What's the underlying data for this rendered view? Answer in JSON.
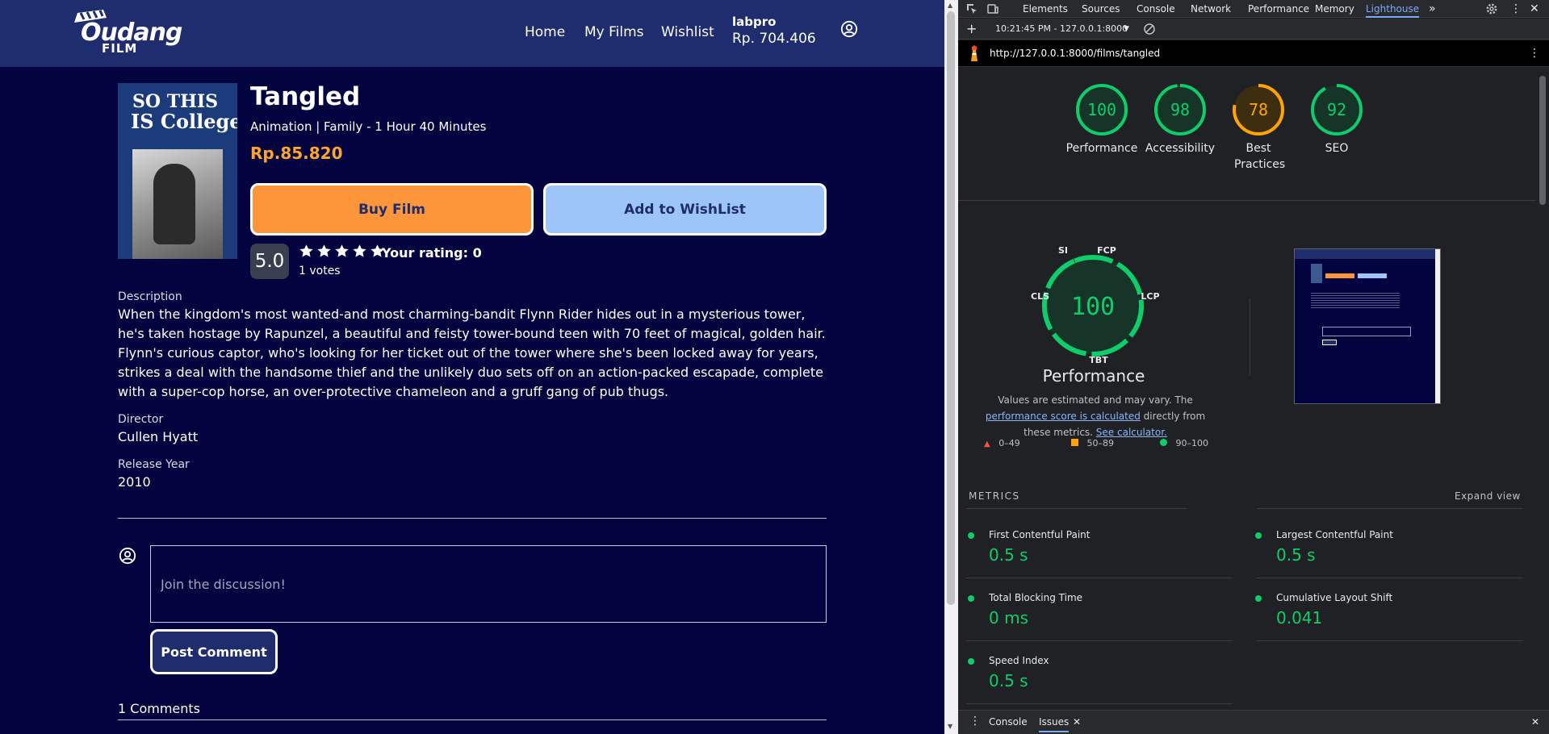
{
  "site": {
    "logo": {
      "line1": "Oudang",
      "line2": "FILM"
    },
    "nav": {
      "links": [
        "Home",
        "My Films",
        "Wishlist"
      ],
      "user_name": "labpro",
      "balance": "Rp. 704.406"
    },
    "poster": {
      "line1": "SO THIS",
      "line2": "IS College"
    },
    "film": {
      "title": "Tangled",
      "meta": "Animation | Family - 1 Hour 40 Minutes",
      "price": "Rp.85.820",
      "buy_label": "Buy Film",
      "wishlist_label": "Add to WishList",
      "rating": "5.0",
      "stars": 5,
      "your_rating": "Your rating: 0",
      "votes": "1 votes",
      "description_label": "Description",
      "description": "When the kingdom's most wanted-and most charming-bandit Flynn Rider hides out in a mysterious tower, he's taken hostage by Rapunzel, a beautiful and feisty tower-bound teen with 70 feet of magical, golden hair. Flynn's curious captor, who's looking for her ticket out of the tower where she's been locked away for years, strikes a deal with the handsome thief and the unlikely duo sets off on an action-packed escapade, complete with a super-cop horse, an over-protective chameleon and a gruff gang of pub thugs.",
      "director_label": "Director",
      "director": "Cullen Hyatt",
      "release_label": "Release Year",
      "release_year": "2010"
    },
    "comments": {
      "placeholder": "Join the discussion!",
      "post_label": "Post Comment",
      "count_label": "1 Comments"
    },
    "colors": {
      "nav_bg": "#1f2c6e",
      "page_bg": "#02033f",
      "price": "#ffa42e",
      "buy_button": "#fd963b",
      "wishlist_button": "#9ec5fa"
    }
  },
  "devtools": {
    "tabs": [
      "Elements",
      "Sources",
      "Console",
      "Network",
      "Performance",
      "Memory",
      "Lighthouse"
    ],
    "active_tab": "Lighthouse",
    "more_tabs_icon": "chevron-double-right-icon",
    "report_time": "10:21:45 PM - 127.0.0.1:8000",
    "url": "http://127.0.0.1:8000/films/tangled",
    "scores": [
      {
        "label": "Performance",
        "score": 100,
        "color": "#0cce6b"
      },
      {
        "label": "Accessibility",
        "score": 98,
        "color": "#0cce6b"
      },
      {
        "label": "Best Practices",
        "score": 78,
        "color": "#ffa400"
      },
      {
        "label": "SEO",
        "score": 92,
        "color": "#0cce6b"
      }
    ],
    "perf_gauge": {
      "score": "100",
      "labels": {
        "si": "SI",
        "fcp": "FCP",
        "lcp": "LCP",
        "tbt": "TBT",
        "cls": "CLS"
      }
    },
    "perf_title": "Performance",
    "perf_note": {
      "before": "Values are estimated and may vary. The ",
      "link1": "performance score is calculated",
      "middle": " directly from these metrics. ",
      "link2": "See calculator."
    },
    "legend": [
      "0–49",
      "50–89",
      "90–100"
    ],
    "metrics_heading": "METRICS",
    "expand_label": "Expand view",
    "metrics": [
      {
        "name": "First Contentful Paint",
        "value": "0.5 s"
      },
      {
        "name": "Largest Contentful Paint",
        "value": "0.5 s"
      },
      {
        "name": "Total Blocking Time",
        "value": "0 ms"
      },
      {
        "name": "Cumulative Layout Shift",
        "value": "0.041"
      },
      {
        "name": "Speed Index",
        "value": "0.5 s"
      }
    ],
    "drawer_tabs": [
      "Console",
      "Issues"
    ],
    "colors": {
      "pass": "#0cce6b",
      "average": "#ffa400",
      "fail": "#ff4e42",
      "link": "#8ab4f8"
    }
  }
}
